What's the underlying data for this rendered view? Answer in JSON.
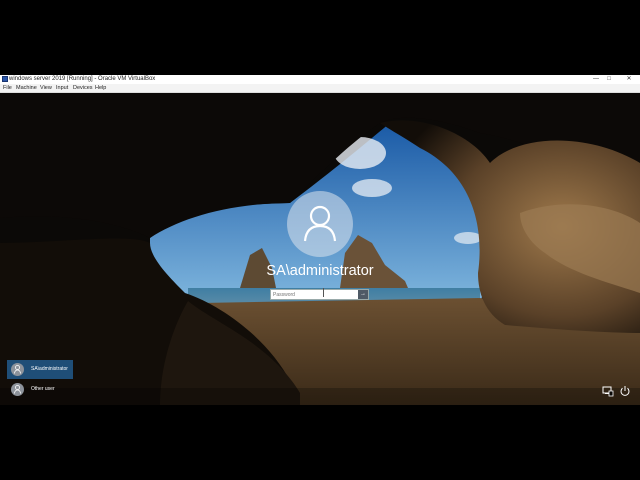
{
  "window": {
    "title": "windows server 2019 [Running] - Oracle VM VirtualBox",
    "minimize": "—",
    "maximize": "□",
    "close": "✕"
  },
  "menu": [
    "File",
    "Machine",
    "View",
    "Input",
    "Devices",
    "Help"
  ],
  "login": {
    "username": "SA\\administrator",
    "password_placeholder": "Password",
    "submit_glyph": "→"
  },
  "users": [
    {
      "label": "SA\\administrator",
      "selected": true
    },
    {
      "label": "Other user",
      "selected": false
    }
  ],
  "icons": {
    "app": "virtualbox-icon",
    "avatar": "user-icon",
    "network": "network-icon",
    "power": "power-icon"
  }
}
